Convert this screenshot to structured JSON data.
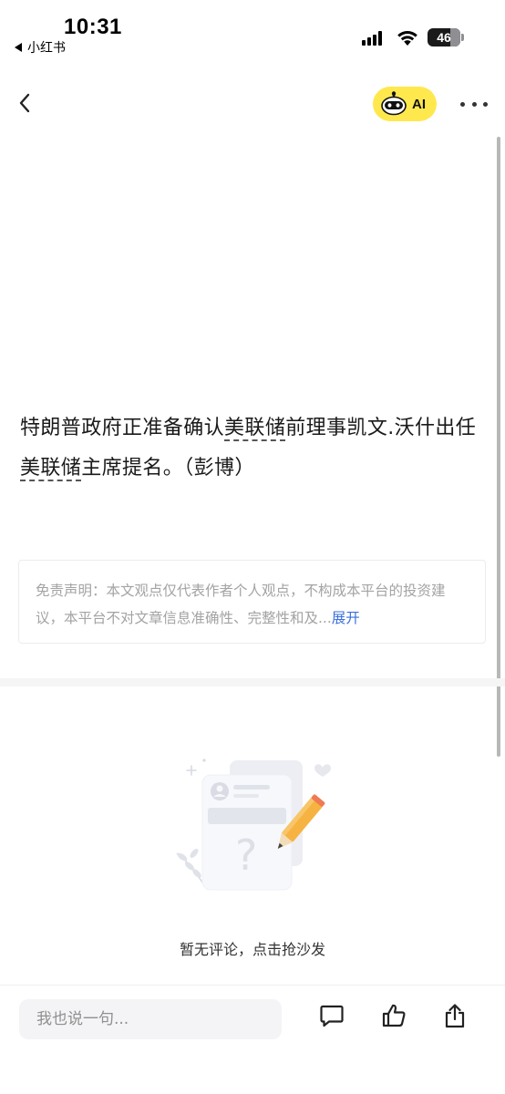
{
  "status_bar": {
    "time": "10:31",
    "back_app": "小红书",
    "battery": "46"
  },
  "nav": {
    "back_icon": "chevron-left-icon",
    "ai_label": "AI",
    "ai_icon": "robot-icon",
    "more_icon": "more-dots-icon",
    "ai_button_color": "#ffe84d"
  },
  "article": {
    "segments": [
      {
        "text": "特朗普政府正准备确认",
        "stock": false
      },
      {
        "text": "美联储",
        "stock": true
      },
      {
        "text": "前理事凯文.沃什出任",
        "stock": false
      },
      {
        "text": "美联储",
        "stock": true
      },
      {
        "text": "主席提名。（彭博）",
        "stock": false
      }
    ]
  },
  "disclaimer": {
    "text": "免责声明：本文观点仅代表作者个人观点，不构成本平台的投资建议，本平台不对文章信息准确性、完整性和及...",
    "expand_label": "展开",
    "expand_color": "#3a6fdb"
  },
  "comments": {
    "empty_text": "暂无评论，点击抢沙发"
  },
  "bottom_bar": {
    "input_placeholder": "我也说一句...",
    "comment_icon": "comment-icon",
    "like_icon": "thumbs-up-icon",
    "share_icon": "share-icon"
  }
}
